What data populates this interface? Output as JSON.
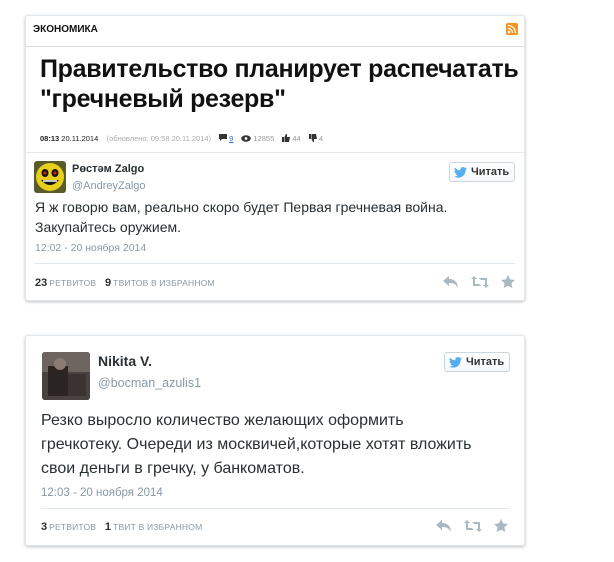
{
  "news": {
    "section": "ЭКОНОМИКА",
    "headline": "Правительство планирует распечатать \"гречневый резерв\"",
    "time": "08:13",
    "date": "20.11.2014",
    "updated": "(обновлено: 09:58 20.11.2014)",
    "comments": "9",
    "views": "12855",
    "likes": "44",
    "dislikes": "4"
  },
  "tweets": [
    {
      "name": "Рөстәм Zalgo",
      "handle": "@AndreyZalgo",
      "follow_label": "Читать",
      "text": "Я ж говорю вам, реально скоро будет Первая гречневая война. Закупайтесь оружием.",
      "timestamp": "12:02 - 20 ноября 2014",
      "retweets": "23",
      "retweets_label": "ретвитов",
      "favorites": "9",
      "favorites_label": "твитов в избранном"
    },
    {
      "name": "Nikita V.",
      "handle": "@bocman_azulis1",
      "follow_label": "Читать",
      "text": "Резко выросло количество желающих оформить гречкотеку. Очереди из москвичей,которые хотят вложить свои деньги в гречку, у банкоматов.",
      "timestamp": "12:03 - 20 ноября 2014",
      "retweets": "3",
      "retweets_label": "ретвитов",
      "favorites": "1",
      "favorites_label": "твит в избранном"
    }
  ],
  "colors": {
    "twitter_blue": "#55acee",
    "action_grey": "#aab8c2",
    "rss_orange": "#f7931e"
  }
}
